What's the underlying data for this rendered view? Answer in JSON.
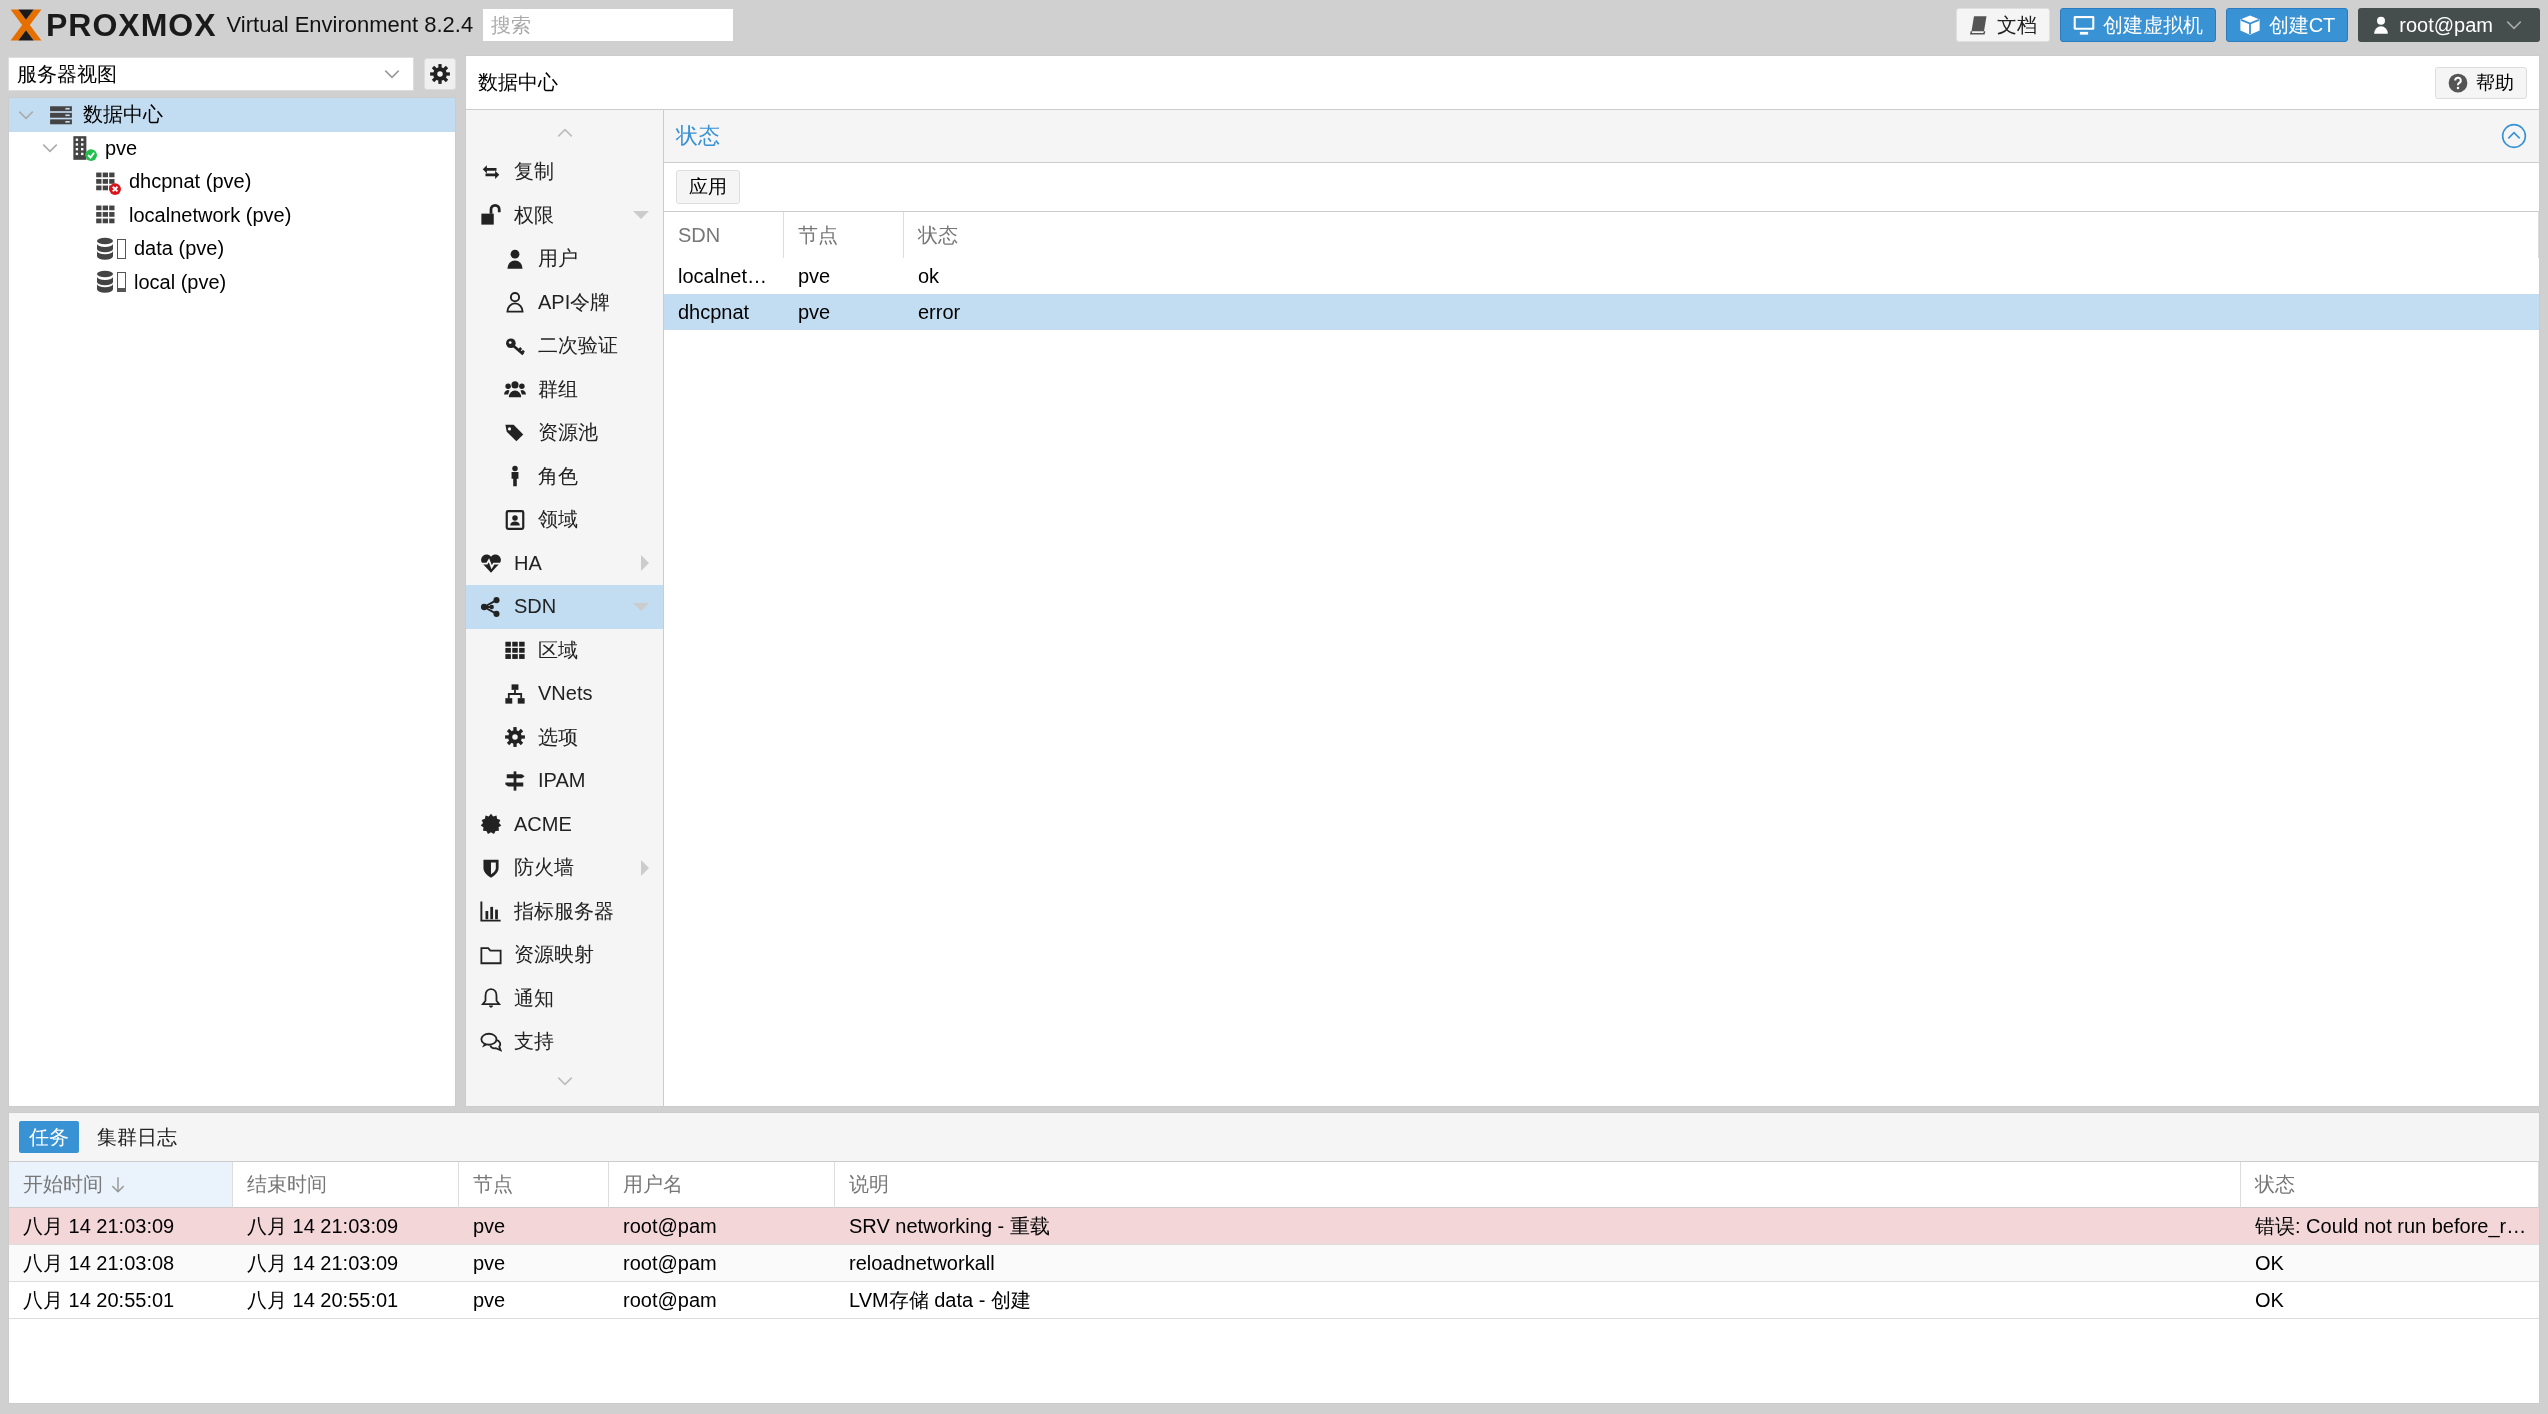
{
  "header": {
    "logo": "PROXMOX",
    "version": "Virtual Environment 8.2.4",
    "search": {
      "placeholder": "搜索"
    },
    "buttons": [
      {
        "label": "文档",
        "kind": "docs"
      },
      {
        "label": "创建虚拟机",
        "kind": "create-vm"
      },
      {
        "label": "创建CT",
        "kind": "create-ct"
      },
      {
        "label": "root@pam",
        "kind": "user"
      }
    ]
  },
  "resource_tree": {
    "view_selector": "服务器视图",
    "nodes": [
      {
        "label": "数据中心",
        "kind": "datacenter",
        "selected": true,
        "expanded": true,
        "children": [
          {
            "label": "pve",
            "kind": "node",
            "online": true,
            "selected": false,
            "expanded": true,
            "children": [
              {
                "label": "dhcpnat (pve)",
                "kind": "zone",
                "error": true,
                "selected": false
              },
              {
                "label": "localnetwork (pve)",
                "kind": "zone",
                "error": false,
                "selected": false
              },
              {
                "label": "data (pve)",
                "kind": "storage",
                "selected": false
              },
              {
                "label": "local (pve)",
                "kind": "storage",
                "level": 0.2,
                "selected": false
              }
            ]
          }
        ]
      }
    ]
  },
  "content": {
    "breadcrumb": "数据中心",
    "help_button": "帮助",
    "nav": [
      {
        "label": "复制",
        "kind": "replication",
        "selected": false
      },
      {
        "label": "权限",
        "kind": "permissions",
        "selected": false,
        "expanded": true,
        "children": [
          {
            "label": "用户",
            "kind": "users",
            "selected": false
          },
          {
            "label": "API令牌",
            "kind": "api-token",
            "selected": false
          },
          {
            "label": "二次验证",
            "kind": "tfa",
            "selected": false
          },
          {
            "label": "群组",
            "kind": "groups",
            "selected": false
          },
          {
            "label": "资源池",
            "kind": "pools",
            "selected": false
          },
          {
            "label": "角色",
            "kind": "roles",
            "selected": false
          },
          {
            "label": "领域",
            "kind": "realms",
            "selected": false
          }
        ]
      },
      {
        "label": "HA",
        "kind": "ha",
        "selected": false,
        "expanded": false
      },
      {
        "label": "SDN",
        "kind": "sdn",
        "selected": true,
        "expanded": true,
        "children": [
          {
            "label": "区域",
            "kind": "zones",
            "selected": false
          },
          {
            "label": "VNets",
            "kind": "vnets",
            "selected": false
          },
          {
            "label": "选项",
            "kind": "options",
            "selected": false
          },
          {
            "label": "IPAM",
            "kind": "ipam",
            "selected": false
          }
        ]
      },
      {
        "label": "ACME",
        "kind": "acme",
        "selected": false
      },
      {
        "label": "防火墙",
        "kind": "firewall",
        "selected": false,
        "expanded": false
      },
      {
        "label": "指标服务器",
        "kind": "metric-server",
        "selected": false
      },
      {
        "label": "资源映射",
        "kind": "resource-mapping",
        "selected": false
      },
      {
        "label": "通知",
        "kind": "notifications",
        "selected": false
      },
      {
        "label": "支持",
        "kind": "support",
        "selected": false
      }
    ],
    "status_panel": {
      "title": "状态",
      "toolbar_button": "应用",
      "columns": [
        "SDN",
        "节点",
        "状态"
      ],
      "rows": [
        {
          "cells": [
            "localnet…",
            "pve",
            "ok"
          ],
          "selected": false
        },
        {
          "cells": [
            "dhcpnat",
            "pve",
            "error"
          ],
          "selected": true
        }
      ]
    }
  },
  "log_panel": {
    "tabs": [
      {
        "label": "任务",
        "selected": true
      },
      {
        "label": "集群日志",
        "selected": false
      }
    ],
    "columns": [
      {
        "label": "开始时间",
        "sorted": true
      },
      {
        "label": "结束时间",
        "sorted": false
      },
      {
        "label": "节点",
        "sorted": false
      },
      {
        "label": "用户名",
        "sorted": false
      },
      {
        "label": "说明",
        "sorted": false
      },
      {
        "label": "状态",
        "sorted": false
      }
    ],
    "rows": [
      {
        "cells": [
          "八月 14 21:03:09",
          "八月 14 21:03:09",
          "pve",
          "root@pam",
          "SRV networking - 重载",
          "错误: Could not run before_r…"
        ],
        "error": true
      },
      {
        "cells": [
          "八月 14 21:03:08",
          "八月 14 21:03:09",
          "pve",
          "root@pam",
          "reloadnetworkall",
          "OK"
        ],
        "error": false
      },
      {
        "cells": [
          "八月 14 20:55:01",
          "八月 14 20:55:01",
          "pve",
          "root@pam",
          "LVM存储 data - 创建",
          "OK"
        ],
        "error": false
      }
    ]
  }
}
